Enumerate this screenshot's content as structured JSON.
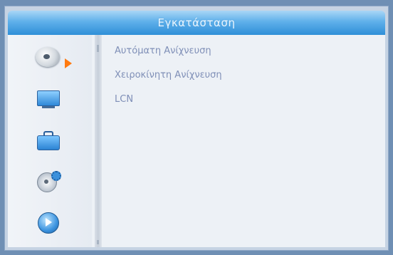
{
  "window": {
    "title": "Εγκατάσταση"
  },
  "sidebar": {
    "items": [
      {
        "name": "satellite-dish",
        "icon": "satellite-dish-icon",
        "active": true
      },
      {
        "name": "tv",
        "icon": "tv-icon",
        "active": false
      },
      {
        "name": "briefcase",
        "icon": "briefcase-icon",
        "active": false
      },
      {
        "name": "disc-settings",
        "icon": "disc-gear-icon",
        "active": false
      },
      {
        "name": "play",
        "icon": "play-icon",
        "active": false
      }
    ]
  },
  "menu": {
    "items": [
      {
        "label": "Αυτόματη Ανίχνευση"
      },
      {
        "label": "Χειροκίνητη Ανίχνευση"
      },
      {
        "label": "LCN"
      }
    ]
  },
  "colors": {
    "title_bar": "#3f9de2",
    "menu_text": "#7f8fb7",
    "active_arrow": "#ff7a10",
    "background": "#edf1f6"
  }
}
